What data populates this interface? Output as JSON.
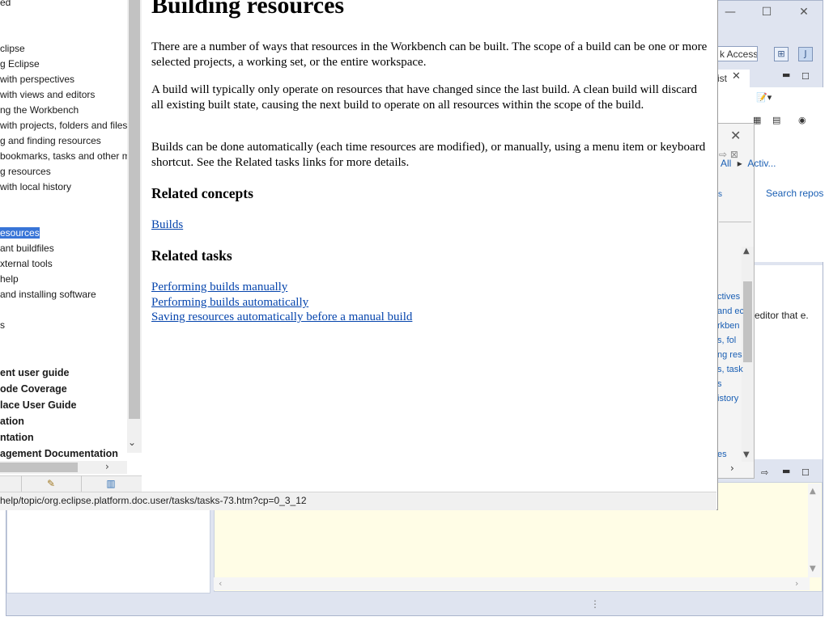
{
  "help": {
    "toc_items": [
      {
        "label": "ed",
        "bold": false,
        "selected": false
      },
      {
        "label": "clipse",
        "bold": false,
        "selected": false
      },
      {
        "label": "g Eclipse",
        "bold": false,
        "selected": false
      },
      {
        "label": "with perspectives",
        "bold": false,
        "selected": false
      },
      {
        "label": "with views and editors",
        "bold": false,
        "selected": false
      },
      {
        "label": "ng the Workbench",
        "bold": false,
        "selected": false
      },
      {
        "label": "with projects, folders and files",
        "bold": false,
        "selected": false
      },
      {
        "label": "g and finding resources",
        "bold": false,
        "selected": false
      },
      {
        "label": " bookmarks, tasks and other m",
        "bold": false,
        "selected": false
      },
      {
        "label": "g resources",
        "bold": false,
        "selected": false
      },
      {
        "label": "with local history",
        "bold": false,
        "selected": false
      },
      {
        "label": "esources",
        "bold": false,
        "selected": true
      },
      {
        "label": "ant buildfiles",
        "bold": false,
        "selected": false
      },
      {
        "label": "xternal tools",
        "bold": false,
        "selected": false
      },
      {
        "label": " help",
        "bold": false,
        "selected": false
      },
      {
        "label": "and installing software",
        "bold": false,
        "selected": false
      },
      {
        "label": "s",
        "bold": false,
        "selected": false
      },
      {
        "label": "ent user guide",
        "bold": true,
        "selected": false
      },
      {
        "label": "ode Coverage",
        "bold": true,
        "selected": false
      },
      {
        "label": "lace User Guide",
        "bold": true,
        "selected": false
      },
      {
        "label": "ation",
        "bold": true,
        "selected": false
      },
      {
        "label": "ntation",
        "bold": true,
        "selected": false
      },
      {
        "label": "agement Documentation",
        "bold": true,
        "selected": false
      }
    ],
    "content": {
      "title": "Building resources",
      "para1": "There are a number of ways that resources in the Workbench can be built. The scope of a build can be one or more selected projects, a working set, or the entire workspace.",
      "para2": "A build will typically only operate on resources that have changed since the last build. A clean build will discard all existing built state, causing the next build to operate on all resources within the scope of the build.",
      "para3": "Builds can be done automatically (each time resources are modified), or manually, using a menu item or keyboard shortcut. See the Related tasks links for more details.",
      "related_concepts_heading": "Related concepts",
      "concept_links": [
        "Builds"
      ],
      "related_tasks_heading": "Related tasks",
      "task_links": [
        "Performing builds manually",
        "Performing builds automatically",
        "Saving resources automatically before a manual build"
      ]
    },
    "status_url": "help/topic/org.eclipse.platform.doc.user/tasks/tasks-73.htm?cp=0_3_12"
  },
  "eclipse": {
    "window_controls": {
      "minimize": "—",
      "maximize": "☐",
      "close": "✕"
    },
    "quick_access_text": "k Access",
    "view_tab_label": "ist",
    "popup_links": {
      "all": "All",
      "active": "Activ..."
    },
    "search_repos": "Search repos",
    "side_label": "s",
    "mid_text": "editor that e.",
    "mid_links": [
      "ctives",
      "and ec",
      "rkben",
      "s, fol",
      "ng res",
      "s, task",
      "s",
      "istory"
    ],
    "mid_bottom": "es"
  }
}
